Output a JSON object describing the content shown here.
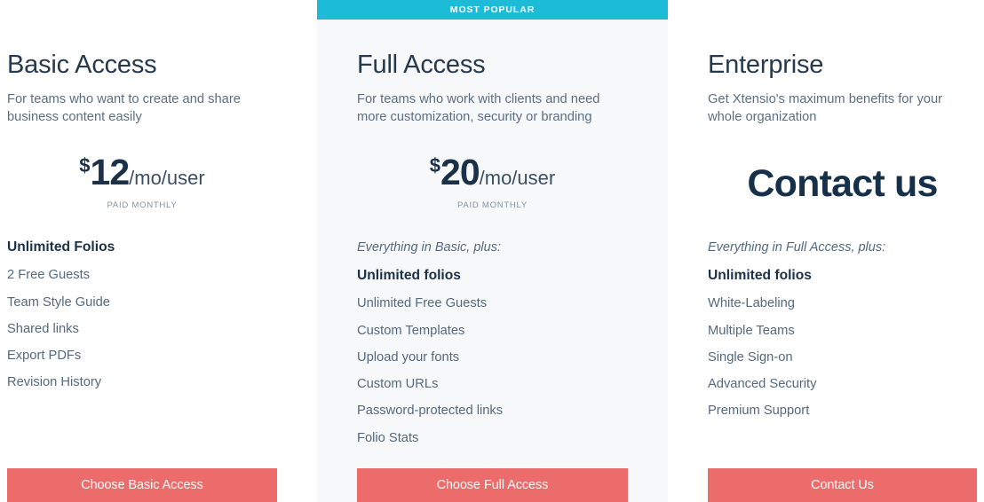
{
  "page": {
    "accent_cyan": "#1CBCD8",
    "accent_coral": "#EC6B6B",
    "heading_color": "#26394D",
    "body_color": "#55697E",
    "highlight_bg": "#F7F8FA"
  },
  "plans": [
    {
      "id": "basic",
      "badge": null,
      "title": "Basic Access",
      "description": "For teams who want to create and share business content easily",
      "price": {
        "currency": "$",
        "amount": "12",
        "period": "/mo/user",
        "note": "PAID MONTHLY"
      },
      "features_intro": null,
      "features": [
        {
          "label": "Unlimited Folios",
          "strong": true
        },
        {
          "label": "2 Free Guests",
          "strong": false
        },
        {
          "label": "Team Style Guide",
          "strong": false
        },
        {
          "label": "Shared links",
          "strong": false
        },
        {
          "label": "Export PDFs",
          "strong": false
        },
        {
          "label": "Revision History",
          "strong": false
        }
      ],
      "cta_label": "Choose Basic Access"
    },
    {
      "id": "full",
      "badge": "MOST POPULAR",
      "title": "Full Access",
      "description": "For teams who work with clients and need more customization, security or branding",
      "price": {
        "currency": "$",
        "amount": "20",
        "period": "/mo/user",
        "note": "PAID MONTHLY"
      },
      "features_intro": "Everything in Basic, plus:",
      "features": [
        {
          "label": "Unlimited folios",
          "strong": true
        },
        {
          "label": "Unlimited Free Guests",
          "strong": false
        },
        {
          "label": "Custom Templates",
          "strong": false
        },
        {
          "label": "Upload your fonts",
          "strong": false
        },
        {
          "label": "Custom URLs",
          "strong": false
        },
        {
          "label": "Password-protected links",
          "strong": false
        },
        {
          "label": "Folio Stats",
          "strong": false
        }
      ],
      "cta_label": "Choose Full Access"
    },
    {
      "id": "enterprise",
      "badge": null,
      "title": "Enterprise",
      "description": "Get Xtensio's maximum benefits for your whole organization",
      "price": {
        "contact_text": "Contact us"
      },
      "features_intro": "Everything in Full Access, plus:",
      "features": [
        {
          "label": "Unlimited folios",
          "strong": true
        },
        {
          "label": "White-Labeling",
          "strong": false
        },
        {
          "label": "Multiple Teams",
          "strong": false
        },
        {
          "label": "Single Sign-on",
          "strong": false
        },
        {
          "label": "Advanced Security",
          "strong": false
        },
        {
          "label": "Premium Support",
          "strong": false
        }
      ],
      "cta_label": "Contact Us"
    }
  ]
}
